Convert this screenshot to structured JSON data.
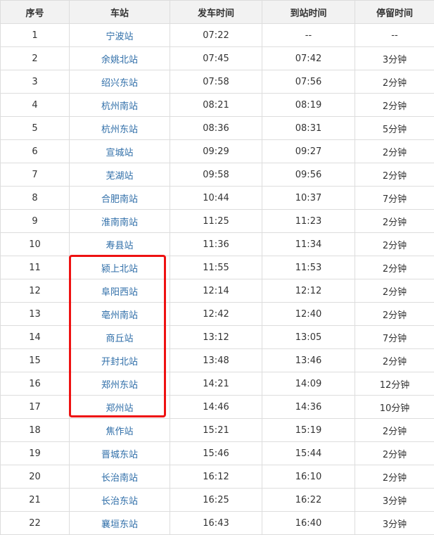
{
  "headers": [
    "序号",
    "车站",
    "发车时间",
    "到站时间",
    "停留时间"
  ],
  "rows": [
    {
      "no": "1",
      "station": "宁波站",
      "depart": "07:22",
      "arrive": "--",
      "stop": "--"
    },
    {
      "no": "2",
      "station": "余姚北站",
      "depart": "07:45",
      "arrive": "07:42",
      "stop": "3分钟"
    },
    {
      "no": "3",
      "station": "绍兴东站",
      "depart": "07:58",
      "arrive": "07:56",
      "stop": "2分钟"
    },
    {
      "no": "4",
      "station": "杭州南站",
      "depart": "08:21",
      "arrive": "08:19",
      "stop": "2分钟"
    },
    {
      "no": "5",
      "station": "杭州东站",
      "depart": "08:36",
      "arrive": "08:31",
      "stop": "5分钟"
    },
    {
      "no": "6",
      "station": "宣城站",
      "depart": "09:29",
      "arrive": "09:27",
      "stop": "2分钟"
    },
    {
      "no": "7",
      "station": "芜湖站",
      "depart": "09:58",
      "arrive": "09:56",
      "stop": "2分钟"
    },
    {
      "no": "8",
      "station": "合肥南站",
      "depart": "10:44",
      "arrive": "10:37",
      "stop": "7分钟"
    },
    {
      "no": "9",
      "station": "淮南南站",
      "depart": "11:25",
      "arrive": "11:23",
      "stop": "2分钟"
    },
    {
      "no": "10",
      "station": "寿县站",
      "depart": "11:36",
      "arrive": "11:34",
      "stop": "2分钟"
    },
    {
      "no": "11",
      "station": "颍上北站",
      "depart": "11:55",
      "arrive": "11:53",
      "stop": "2分钟"
    },
    {
      "no": "12",
      "station": "阜阳西站",
      "depart": "12:14",
      "arrive": "12:12",
      "stop": "2分钟"
    },
    {
      "no": "13",
      "station": "亳州南站",
      "depart": "12:42",
      "arrive": "12:40",
      "stop": "2分钟"
    },
    {
      "no": "14",
      "station": "商丘站",
      "depart": "13:12",
      "arrive": "13:05",
      "stop": "7分钟"
    },
    {
      "no": "15",
      "station": "开封北站",
      "depart": "13:48",
      "arrive": "13:46",
      "stop": "2分钟"
    },
    {
      "no": "16",
      "station": "郑州东站",
      "depart": "14:21",
      "arrive": "14:09",
      "stop": "12分钟"
    },
    {
      "no": "17",
      "station": "郑州站",
      "depart": "14:46",
      "arrive": "14:36",
      "stop": "10分钟"
    },
    {
      "no": "18",
      "station": "焦作站",
      "depart": "15:21",
      "arrive": "15:19",
      "stop": "2分钟"
    },
    {
      "no": "19",
      "station": "晋城东站",
      "depart": "15:46",
      "arrive": "15:44",
      "stop": "2分钟"
    },
    {
      "no": "20",
      "station": "长治南站",
      "depart": "16:12",
      "arrive": "16:10",
      "stop": "2分钟"
    },
    {
      "no": "21",
      "station": "长治东站",
      "depart": "16:25",
      "arrive": "16:22",
      "stop": "3分钟"
    },
    {
      "no": "22",
      "station": "襄垣东站",
      "depart": "16:43",
      "arrive": "16:40",
      "stop": "3分钟"
    }
  ],
  "colors": {
    "link": "#2f6ea8",
    "highlight": "#ee1111",
    "header_bg": "#f2f2f2"
  }
}
